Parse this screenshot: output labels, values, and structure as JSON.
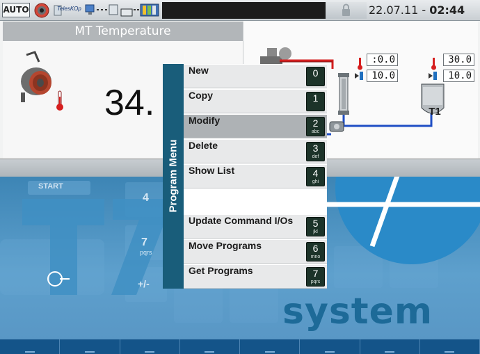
{
  "status": {
    "mode": "AUTO",
    "telescop": "TelesKOp",
    "date": "22.07.11 - ",
    "time": "02:44"
  },
  "process": {
    "title": "MT Temperature",
    "value": "34.",
    "left_actual": ":0.0",
    "left_set": "10.0",
    "right_actual": "30.0",
    "right_set": "10.0",
    "tank_label": "T1"
  },
  "menu": {
    "title": "Program Menu",
    "items": [
      {
        "label": "New",
        "key": "0",
        "alpha": ""
      },
      {
        "label": "Copy",
        "key": "1",
        "alpha": ""
      },
      {
        "label": "Modify",
        "key": "2",
        "alpha": "abc"
      },
      {
        "label": "Delete",
        "key": "3",
        "alpha": "def"
      },
      {
        "label": "Show List",
        "key": "4",
        "alpha": "ghi"
      },
      {
        "label": "Update Command I/Os",
        "key": "5",
        "alpha": "jkl"
      },
      {
        "label": "Move Programs",
        "key": "6",
        "alpha": "mno"
      },
      {
        "label": "Get Programs",
        "key": "7",
        "alpha": "pqrs"
      }
    ],
    "selected": "Modify"
  },
  "background": {
    "brand": "system",
    "keypad": [
      "START",
      "4",
      "7",
      "pqrs",
      "+/-",
      "T",
      "7"
    ]
  },
  "colors": {
    "menu_sidebar": "#195d7a",
    "key_badge": "#1c3329",
    "selected_item": "#aeb2b5",
    "brand_blue": "#1d6a98"
  }
}
